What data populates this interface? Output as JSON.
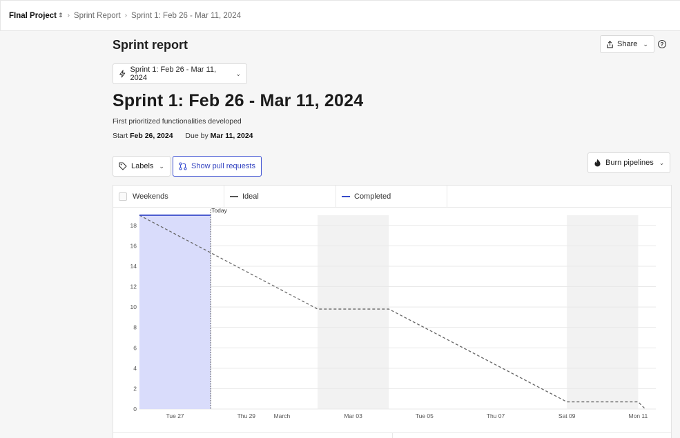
{
  "breadcrumb": {
    "project": "FInal Project",
    "report": "Sprint Report",
    "sprint": "Sprint 1: Feb 26 - Mar 11, 2024"
  },
  "page": {
    "title": "Sprint report",
    "share_label": "Share",
    "help_glyph": "?",
    "sprint_selector_label": "Sprint 1: Feb 26 - Mar 11, 2024",
    "sprint_heading": "Sprint 1: Feb 26 - Mar 11, 2024",
    "description": "First prioritized functionalities developed",
    "start_label": "Start",
    "start_date": "Feb 26, 2024",
    "due_label": "Due by",
    "due_date": "Mar 11, 2024"
  },
  "toolbar": {
    "labels_button": "Labels",
    "pull_requests_button": "Show pull requests",
    "burn_pipelines_button": "Burn pipelines"
  },
  "legend": {
    "weekends": "Weekends",
    "ideal": "Ideal",
    "completed": "Completed"
  },
  "colors": {
    "completed": "#3749c9",
    "completed_fill": "#d9dcfb",
    "ideal": "#666666",
    "weekend_fill": "#f2f2f2",
    "accent_border": "#3b4fd1"
  },
  "icons": {
    "share": "share-icon",
    "sprint": "lightning-icon",
    "labels": "tag-icon",
    "pull_requests": "pull-request-icon",
    "burn": "flame-icon",
    "help": "help-icon"
  },
  "chart_data": {
    "type": "line",
    "today_label": "Today",
    "ylim": [
      0,
      19
    ],
    "yticks": [
      0,
      2,
      4,
      6,
      8,
      10,
      12,
      14,
      16,
      18
    ],
    "x_range_days": [
      0,
      14.2
    ],
    "xtick_labels": [
      {
        "day": 1,
        "label": "Tue 27"
      },
      {
        "day": 3,
        "label": "Thu 29"
      },
      {
        "day": 4,
        "label": "March"
      },
      {
        "day": 6,
        "label": "Mar 03"
      },
      {
        "day": 8,
        "label": "Tue 05"
      },
      {
        "day": 10,
        "label": "Thu 07"
      },
      {
        "day": 12,
        "label": "Sat 09"
      },
      {
        "day": 14,
        "label": "Mon 11"
      }
    ],
    "weekends": [
      [
        5,
        7
      ],
      [
        12,
        14
      ]
    ],
    "today_day": 2,
    "series": [
      {
        "name": "Ideal",
        "x": [
          0,
          5,
          7,
          12,
          14,
          14.2
        ],
        "y": [
          19,
          9.8,
          9.8,
          0.7,
          0.7,
          0
        ]
      },
      {
        "name": "Completed",
        "x": [
          0,
          2
        ],
        "y": [
          19,
          19
        ]
      }
    ]
  }
}
